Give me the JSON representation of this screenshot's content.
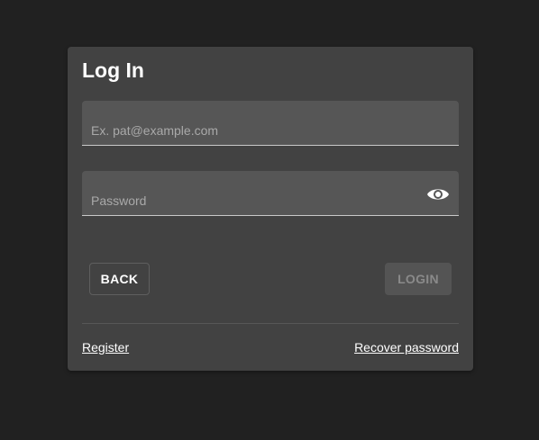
{
  "login_card": {
    "title": "Log In",
    "email_field": {
      "placeholder": "Ex. pat@example.com",
      "value": ""
    },
    "password_field": {
      "placeholder": "Password",
      "value": "",
      "toggle_icon": "eye-icon"
    },
    "back_label": "BACK",
    "login_label": "LOGIN",
    "register_label": "Register",
    "recover_label": "Recover password"
  },
  "colors": {
    "background": "#212121",
    "card": "#424242",
    "field": "#565656",
    "text": "#ffffff",
    "placeholder": "#a9a9a9",
    "disabled_button": "#545454",
    "disabled_text": "#8a8a8a"
  }
}
